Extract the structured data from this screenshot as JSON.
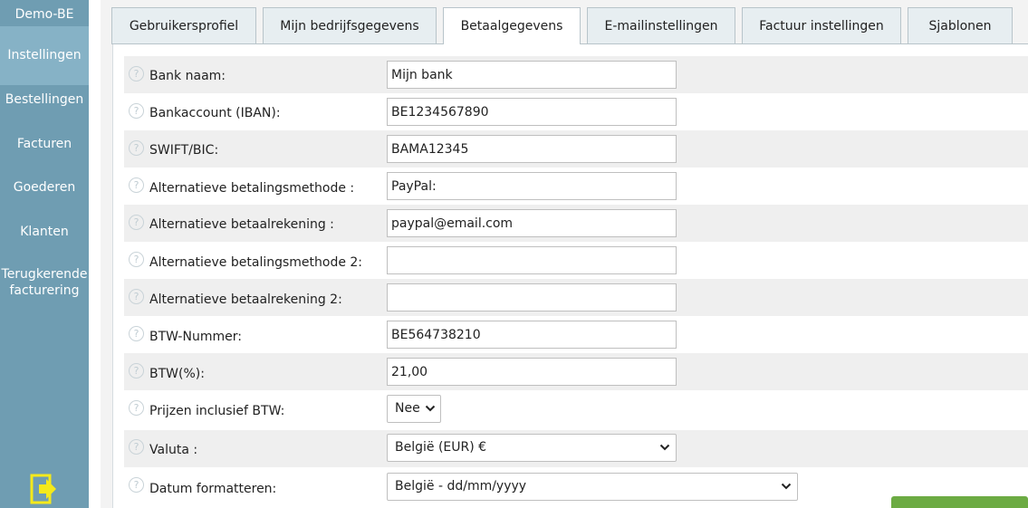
{
  "sidebar": {
    "title": "Demo-BE",
    "items": [
      {
        "label": "Instellingen"
      },
      {
        "label": "Bestellingen"
      },
      {
        "label": "Facturen"
      },
      {
        "label": "Goederen"
      },
      {
        "label": "Klanten"
      },
      {
        "label": "Terugkerende facturering"
      }
    ],
    "exit_icon": "exit-icon"
  },
  "tabs": [
    {
      "label": "Gebruikersprofiel"
    },
    {
      "label": "Mijn bedrijfsgegevens"
    },
    {
      "label": "Betaalgegevens"
    },
    {
      "label": "E-mailinstellingen"
    },
    {
      "label": "Factuur instellingen"
    },
    {
      "label": "Sjablonen"
    }
  ],
  "help_glyph": "?",
  "form": {
    "fields": [
      {
        "label": "Bank naam:",
        "value": "Mijn bank"
      },
      {
        "label": "Bankaccount (IBAN):",
        "value": "BE1234567890"
      },
      {
        "label": "SWIFT/BIC:",
        "value": "BAMA12345"
      },
      {
        "label": "Alternatieve betalingsmethode :",
        "value": "PayPal:"
      },
      {
        "label": "Alternatieve betaalrekening :",
        "value": "paypal@email.com"
      },
      {
        "label": "Alternatieve betalingsmethode 2:",
        "value": ""
      },
      {
        "label": "Alternatieve betaalrekening 2:",
        "value": ""
      },
      {
        "label": "BTW-Nummer:",
        "value": "BE564738210"
      },
      {
        "label": "BTW(%):",
        "value": "21,00"
      }
    ],
    "prices_incl_vat": {
      "label": "Prijzen inclusief BTW:",
      "value": "Nee"
    },
    "currency": {
      "label": "Valuta :",
      "value": "België (EUR) €"
    },
    "date_format": {
      "label": "Datum formatteren:",
      "value": "België - dd/mm/yyyy"
    }
  },
  "colors": {
    "sidebar": "#6f9db2",
    "active_sidebar": "#86b2c6",
    "accent_button": "#6cab43",
    "exit_icon": "#f4e91b"
  }
}
